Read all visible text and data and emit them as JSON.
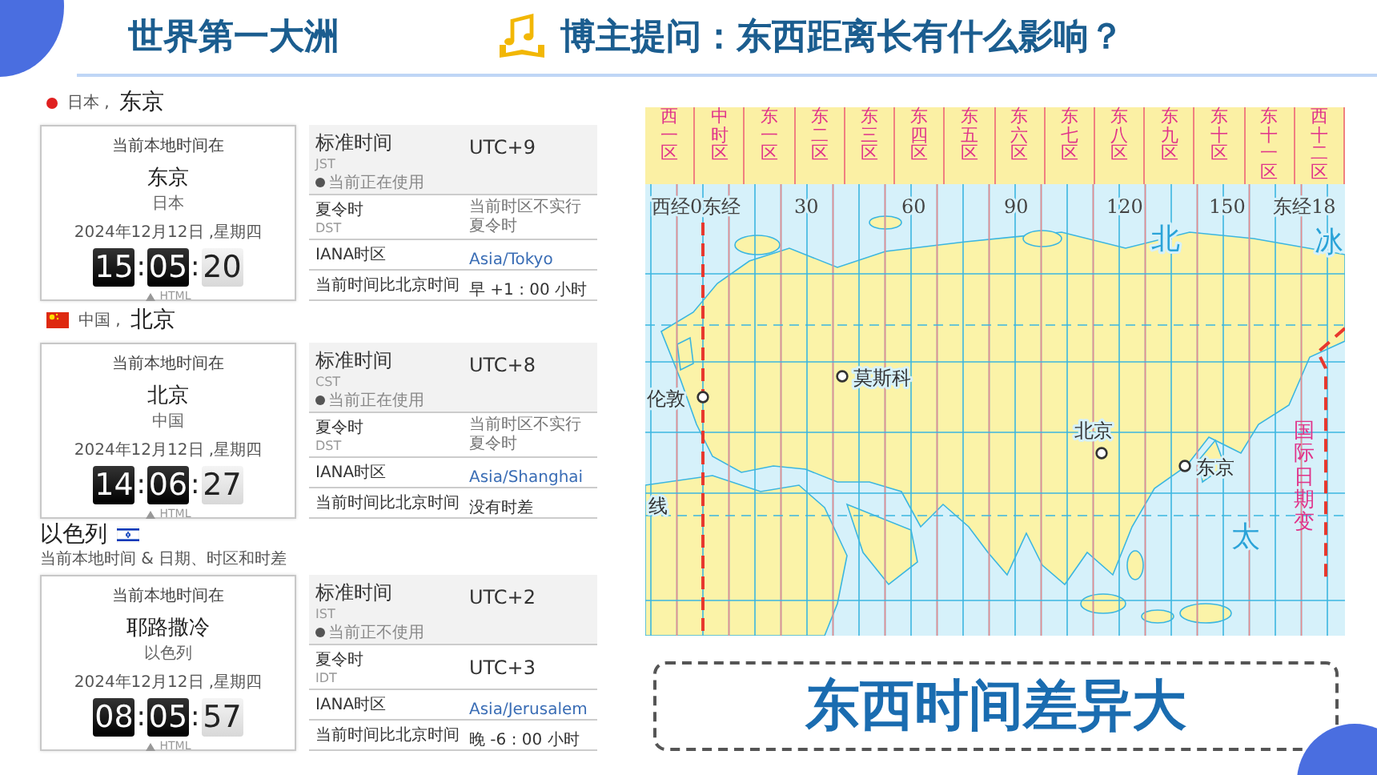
{
  "header": {
    "title": "世界第一大洲",
    "question": "博主提问：东西距离长有什么影响？"
  },
  "clocks": [
    {
      "head": {
        "kind": "dot",
        "country": "日本 ,",
        "city": "东京"
      },
      "card": {
        "caption": "当前本地时间在",
        "city": "东京",
        "country": "日本",
        "date": "2024年12月12日 ,星期四",
        "hours": "15",
        "separator_1": ":",
        "minutes": "05",
        "separator_2": ":",
        "seconds": "20",
        "footer": "HTML"
      },
      "rows": [
        {
          "kind": "standard",
          "label": "标准时间",
          "abbr": "JST",
          "note": "当前正在使用",
          "value": "UTC+9"
        },
        {
          "kind": "dst",
          "label": "夏令时",
          "abbr": "DST",
          "note": "当前时区不实行夏令时"
        },
        {
          "kind": "iana",
          "label": "IANA时区",
          "value": "Asia/Tokyo"
        },
        {
          "kind": "diff",
          "label": "当前时间比北京时间",
          "value": "早 +1 : 00 小时"
        }
      ]
    },
    {
      "head": {
        "kind": "flag",
        "country": "中国 ,",
        "city": "北京"
      },
      "card": {
        "caption": "当前本地时间在",
        "city": "北京",
        "country": "中国",
        "date": "2024年12月12日 ,星期四",
        "hours": "14",
        "separator_1": ":",
        "minutes": "06",
        "separator_2": ":",
        "seconds": "27",
        "footer": "HTML"
      },
      "rows": [
        {
          "kind": "standard",
          "label": "标准时间",
          "abbr": "CST",
          "note": "当前正在使用",
          "value": "UTC+8"
        },
        {
          "kind": "dst",
          "label": "夏令时",
          "abbr": "DST",
          "note": "当前时区不实行夏令时"
        },
        {
          "kind": "iana",
          "label": "IANA时区",
          "value": "Asia/Shanghai"
        },
        {
          "kind": "diff",
          "label": "当前时间比北京时间",
          "value": "没有时差"
        }
      ]
    },
    {
      "head": {
        "kind": "country",
        "title": "以色列",
        "subtitle": "当前本地时间 & 日期、时区和时差"
      },
      "card": {
        "caption": "当前本地时间在",
        "city": "耶路撒冷",
        "country": "以色列",
        "date": "2024年12月12日 ,星期四",
        "hours": "08",
        "separator_1": ":",
        "minutes": "05",
        "separator_2": ":",
        "seconds": "57",
        "footer": "HTML"
      },
      "rows": [
        {
          "kind": "standard",
          "label": "标准时间",
          "abbr": "IST",
          "note": "当前正不使用",
          "value": "UTC+2"
        },
        {
          "kind": "dst",
          "label": "夏令时",
          "abbr": "IDT",
          "value": "UTC+3"
        },
        {
          "kind": "iana",
          "label": "IANA时区",
          "value": "Asia/Jerusalem"
        },
        {
          "kind": "diff",
          "label": "当前时间比北京时间",
          "value": "晚 -6 : 00 小时"
        }
      ]
    }
  ],
  "map": {
    "zones": [
      "西一区",
      "中时区",
      "东一区",
      "东二区",
      "东三区",
      "东四区",
      "东五区",
      "东六区",
      "东七区",
      "东八区",
      "东九区",
      "东十区",
      "东十一区",
      "西十二区"
    ],
    "longitudes": [
      "西经0东经",
      "30",
      "60",
      "90",
      "120",
      "150",
      "东经18"
    ],
    "cities": [
      "伦敦",
      "莫斯科",
      "北京",
      "东京"
    ],
    "labels": [
      "北",
      "冰",
      "太",
      "线",
      "国际日期变"
    ]
  },
  "conclusion": "东西时间差异大"
}
